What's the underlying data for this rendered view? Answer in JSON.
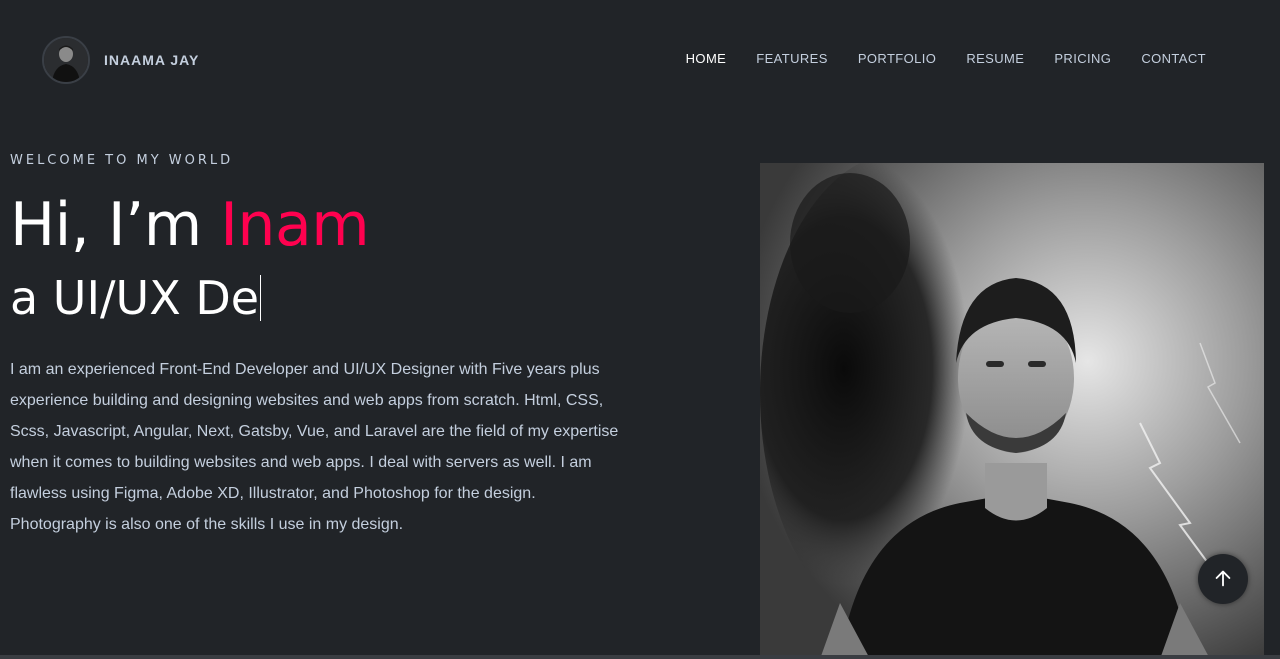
{
  "header": {
    "brand_name": "INAAMA JAY",
    "nav": [
      {
        "label": "HOME",
        "active": true
      },
      {
        "label": "FEATURES",
        "active": false
      },
      {
        "label": "PORTFOLIO",
        "active": false
      },
      {
        "label": "RESUME",
        "active": false
      },
      {
        "label": "PRICING",
        "active": false
      },
      {
        "label": "CONTACT",
        "active": false
      }
    ]
  },
  "hero": {
    "eyebrow": "WELCOME TO MY WORLD",
    "greeting_prefix": "Hi, I’m ",
    "greeting_name": "Inam",
    "role_typed": "a UI/UX De",
    "bio": "I am an experienced Front-End Developer and UI/UX Designer with Five years plus experience building and designing websites and web apps from scratch. Html, CSS, Scss, Javascript, Angular, Next, Gatsby, Vue, and Laravel are the field of my expertise when it comes to building websites and web apps. I deal with servers as well. I am flawless using Figma, Adobe XD, Illustrator, and Photoshop for the design. Photography is also one of the skills I use in my design."
  },
  "icons": {
    "scroll_top": "arrow-up-icon"
  },
  "colors": {
    "background": "#212428",
    "accent": "#ff014f",
    "text": "#c4cfde",
    "heading": "#ffffff"
  }
}
